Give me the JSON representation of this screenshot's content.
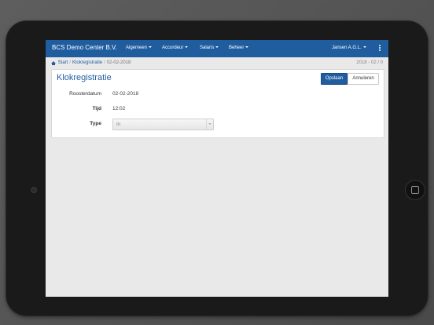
{
  "navbar": {
    "brand": "BCS Demo Center B.V.",
    "items": [
      {
        "label": "Algemeen"
      },
      {
        "label": "Accordeur"
      },
      {
        "label": "Salaris"
      },
      {
        "label": "Beheer"
      }
    ],
    "user_label": "Jansen A.G.L."
  },
  "breadcrumb": {
    "home": "Start",
    "section": "Klokregistratie",
    "current": "02-02-2018",
    "period": "2018 - 02 / 0"
  },
  "page": {
    "title": "Klokregistratie",
    "save_label": "Opslaan",
    "cancel_label": "Annuleren"
  },
  "form": {
    "date_label": "Roosterdatum",
    "date_value": "02-02-2018",
    "time_label": "Tijd",
    "time_value": "12:02",
    "type_label": "Type",
    "type_value": "In"
  },
  "colors": {
    "accent": "#1f5d9f",
    "screen_bg": "#e9e9e9"
  }
}
